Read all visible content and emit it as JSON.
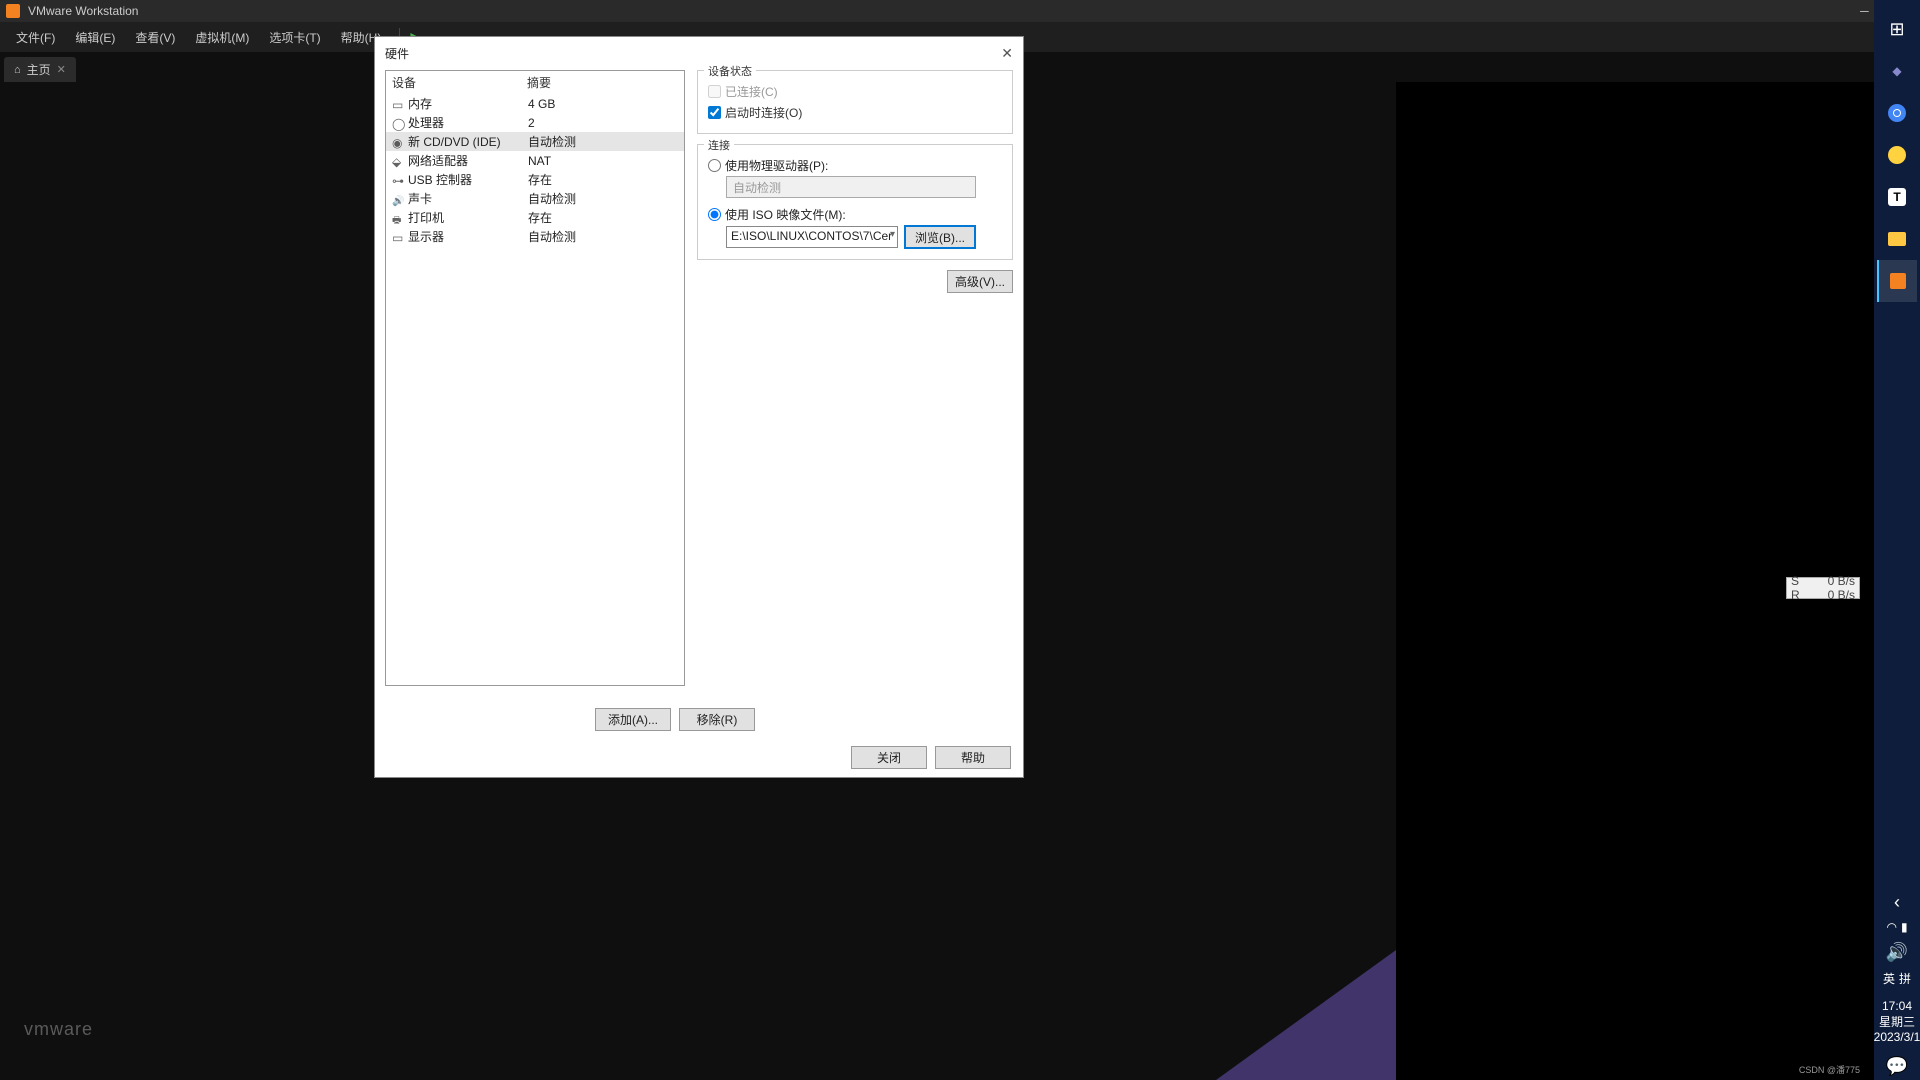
{
  "app": {
    "title": "VMware Workstation"
  },
  "menu": {
    "file": "文件(F)",
    "edit": "编辑(E)",
    "view": "查看(V)",
    "vm": "虚拟机(M)",
    "tabs": "选项卡(T)",
    "help": "帮助(H)"
  },
  "tab": {
    "home": "主页"
  },
  "dialog": {
    "title": "硬件",
    "col_device": "设备",
    "col_summary": "摘要",
    "rows": [
      {
        "name": "内存",
        "summary": "4 GB"
      },
      {
        "name": "处理器",
        "summary": "2"
      },
      {
        "name": "新 CD/DVD (IDE)",
        "summary": "自动检测"
      },
      {
        "name": "网络适配器",
        "summary": "NAT"
      },
      {
        "name": "USB 控制器",
        "summary": "存在"
      },
      {
        "name": "声卡",
        "summary": "自动检测"
      },
      {
        "name": "打印机",
        "summary": "存在"
      },
      {
        "name": "显示器",
        "summary": "自动检测"
      }
    ],
    "grp_state": "设备状态",
    "connected": "已连接(C)",
    "connect_on": "启动时连接(O)",
    "grp_conn": "连接",
    "use_physical": "使用物理驱动器(P):",
    "auto_detect": "自动检测",
    "use_iso": "使用 ISO 映像文件(M):",
    "iso_path": "E:\\ISO\\LINUX\\CONTOS\\7\\Cer",
    "browse": "浏览(B)...",
    "advanced": "高级(V)...",
    "add": "添加(A)...",
    "remove": "移除(R)",
    "close": "关闭",
    "help": "帮助"
  },
  "logo": "vmware",
  "net": {
    "s": "S",
    "r": "R",
    "sv": "0 B/s",
    "rv": "0 B/s"
  },
  "clock": {
    "time": "17:04",
    "day": "星期三",
    "date": "2023/3/1"
  },
  "ime": {
    "lang": "英",
    "mode": "拼"
  },
  "watermark": "CSDN @潘775"
}
